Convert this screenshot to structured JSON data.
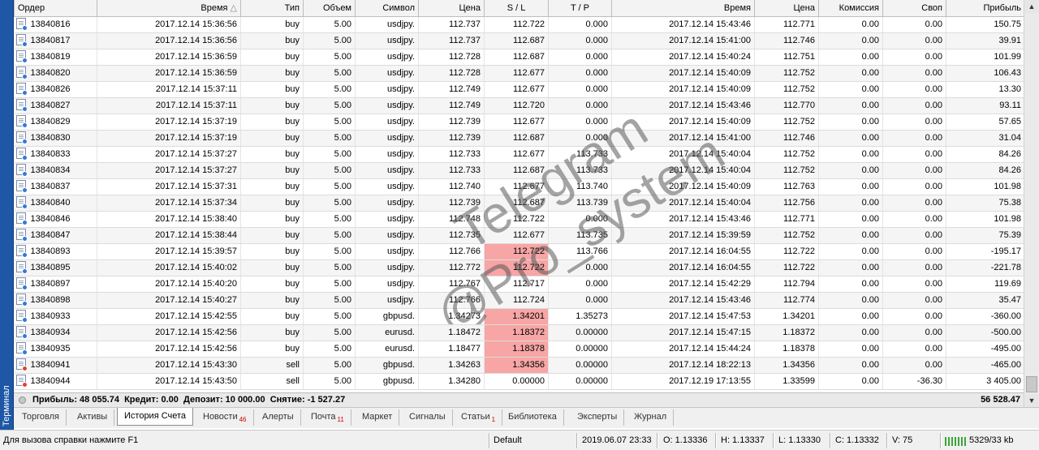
{
  "sidebar": {
    "label": "Терминал"
  },
  "columns": [
    "Ордер",
    "Время",
    "Тип",
    "Объем",
    "Символ",
    "Цена",
    "S / L",
    "T / P",
    "Время",
    "Цена",
    "Комиссия",
    "Своп",
    "Прибыль"
  ],
  "sort_indicator": "△",
  "rows": [
    {
      "order": "13840816",
      "open_time": "2017.12.14 15:36:56",
      "type": "buy",
      "volume": "5.00",
      "symbol": "usdjpy.",
      "price": "112.737",
      "sl": "112.722",
      "tp": "0.000",
      "close_time": "2017.12.14 15:43:46",
      "close_price": "112.771",
      "commission": "0.00",
      "swap": "0.00",
      "profit": "150.75",
      "sl_hit": false
    },
    {
      "order": "13840817",
      "open_time": "2017.12.14 15:36:56",
      "type": "buy",
      "volume": "5.00",
      "symbol": "usdjpy.",
      "price": "112.737",
      "sl": "112.687",
      "tp": "0.000",
      "close_time": "2017.12.14 15:41:00",
      "close_price": "112.746",
      "commission": "0.00",
      "swap": "0.00",
      "profit": "39.91",
      "sl_hit": false
    },
    {
      "order": "13840819",
      "open_time": "2017.12.14 15:36:59",
      "type": "buy",
      "volume": "5.00",
      "symbol": "usdjpy.",
      "price": "112.728",
      "sl": "112.687",
      "tp": "0.000",
      "close_time": "2017.12.14 15:40:24",
      "close_price": "112.751",
      "commission": "0.00",
      "swap": "0.00",
      "profit": "101.99",
      "sl_hit": false
    },
    {
      "order": "13840820",
      "open_time": "2017.12.14 15:36:59",
      "type": "buy",
      "volume": "5.00",
      "symbol": "usdjpy.",
      "price": "112.728",
      "sl": "112.677",
      "tp": "0.000",
      "close_time": "2017.12.14 15:40:09",
      "close_price": "112.752",
      "commission": "0.00",
      "swap": "0.00",
      "profit": "106.43",
      "sl_hit": false
    },
    {
      "order": "13840826",
      "open_time": "2017.12.14 15:37:11",
      "type": "buy",
      "volume": "5.00",
      "symbol": "usdjpy.",
      "price": "112.749",
      "sl": "112.677",
      "tp": "0.000",
      "close_time": "2017.12.14 15:40:09",
      "close_price": "112.752",
      "commission": "0.00",
      "swap": "0.00",
      "profit": "13.30",
      "sl_hit": false
    },
    {
      "order": "13840827",
      "open_time": "2017.12.14 15:37:11",
      "type": "buy",
      "volume": "5.00",
      "symbol": "usdjpy.",
      "price": "112.749",
      "sl": "112.720",
      "tp": "0.000",
      "close_time": "2017.12.14 15:43:46",
      "close_price": "112.770",
      "commission": "0.00",
      "swap": "0.00",
      "profit": "93.11",
      "sl_hit": false
    },
    {
      "order": "13840829",
      "open_time": "2017.12.14 15:37:19",
      "type": "buy",
      "volume": "5.00",
      "symbol": "usdjpy.",
      "price": "112.739",
      "sl": "112.677",
      "tp": "0.000",
      "close_time": "2017.12.14 15:40:09",
      "close_price": "112.752",
      "commission": "0.00",
      "swap": "0.00",
      "profit": "57.65",
      "sl_hit": false
    },
    {
      "order": "13840830",
      "open_time": "2017.12.14 15:37:19",
      "type": "buy",
      "volume": "5.00",
      "symbol": "usdjpy.",
      "price": "112.739",
      "sl": "112.687",
      "tp": "0.000",
      "close_time": "2017.12.14 15:41:00",
      "close_price": "112.746",
      "commission": "0.00",
      "swap": "0.00",
      "profit": "31.04",
      "sl_hit": false
    },
    {
      "order": "13840833",
      "open_time": "2017.12.14 15:37:27",
      "type": "buy",
      "volume": "5.00",
      "symbol": "usdjpy.",
      "price": "112.733",
      "sl": "112.677",
      "tp": "113.733",
      "close_time": "2017.12.14 15:40:04",
      "close_price": "112.752",
      "commission": "0.00",
      "swap": "0.00",
      "profit": "84.26",
      "sl_hit": false
    },
    {
      "order": "13840834",
      "open_time": "2017.12.14 15:37:27",
      "type": "buy",
      "volume": "5.00",
      "symbol": "usdjpy.",
      "price": "112.733",
      "sl": "112.687",
      "tp": "113.733",
      "close_time": "2017.12.14 15:40:04",
      "close_price": "112.752",
      "commission": "0.00",
      "swap": "0.00",
      "profit": "84.26",
      "sl_hit": false
    },
    {
      "order": "13840837",
      "open_time": "2017.12.14 15:37:31",
      "type": "buy",
      "volume": "5.00",
      "symbol": "usdjpy.",
      "price": "112.740",
      "sl": "112.677",
      "tp": "113.740",
      "close_time": "2017.12.14 15:40:09",
      "close_price": "112.763",
      "commission": "0.00",
      "swap": "0.00",
      "profit": "101.98",
      "sl_hit": false
    },
    {
      "order": "13840840",
      "open_time": "2017.12.14 15:37:34",
      "type": "buy",
      "volume": "5.00",
      "symbol": "usdjpy.",
      "price": "112.739",
      "sl": "112.687",
      "tp": "113.739",
      "close_time": "2017.12.14 15:40:04",
      "close_price": "112.756",
      "commission": "0.00",
      "swap": "0.00",
      "profit": "75.38",
      "sl_hit": false
    },
    {
      "order": "13840846",
      "open_time": "2017.12.14 15:38:40",
      "type": "buy",
      "volume": "5.00",
      "symbol": "usdjpy.",
      "price": "112.748",
      "sl": "112.722",
      "tp": "0.000",
      "close_time": "2017.12.14 15:43:46",
      "close_price": "112.771",
      "commission": "0.00",
      "swap": "0.00",
      "profit": "101.98",
      "sl_hit": false
    },
    {
      "order": "13840847",
      "open_time": "2017.12.14 15:38:44",
      "type": "buy",
      "volume": "5.00",
      "symbol": "usdjpy.",
      "price": "112.735",
      "sl": "112.677",
      "tp": "113.735",
      "close_time": "2017.12.14 15:39:59",
      "close_price": "112.752",
      "commission": "0.00",
      "swap": "0.00",
      "profit": "75.39",
      "sl_hit": false
    },
    {
      "order": "13840893",
      "open_time": "2017.12.14 15:39:57",
      "type": "buy",
      "volume": "5.00",
      "symbol": "usdjpy.",
      "price": "112.766",
      "sl": "112.722",
      "tp": "113.766",
      "close_time": "2017.12.14 16:04:55",
      "close_price": "112.722",
      "commission": "0.00",
      "swap": "0.00",
      "profit": "-195.17",
      "sl_hit": true
    },
    {
      "order": "13840895",
      "open_time": "2017.12.14 15:40:02",
      "type": "buy",
      "volume": "5.00",
      "symbol": "usdjpy.",
      "price": "112.772",
      "sl": "112.722",
      "tp": "0.000",
      "close_time": "2017.12.14 16:04:55",
      "close_price": "112.722",
      "commission": "0.00",
      "swap": "0.00",
      "profit": "-221.78",
      "sl_hit": true
    },
    {
      "order": "13840897",
      "open_time": "2017.12.14 15:40:20",
      "type": "buy",
      "volume": "5.00",
      "symbol": "usdjpy.",
      "price": "112.767",
      "sl": "112.717",
      "tp": "0.000",
      "close_time": "2017.12.14 15:42:29",
      "close_price": "112.794",
      "commission": "0.00",
      "swap": "0.00",
      "profit": "119.69",
      "sl_hit": false
    },
    {
      "order": "13840898",
      "open_time": "2017.12.14 15:40:27",
      "type": "buy",
      "volume": "5.00",
      "symbol": "usdjpy.",
      "price": "112.766",
      "sl": "112.724",
      "tp": "0.000",
      "close_time": "2017.12.14 15:43:46",
      "close_price": "112.774",
      "commission": "0.00",
      "swap": "0.00",
      "profit": "35.47",
      "sl_hit": false
    },
    {
      "order": "13840933",
      "open_time": "2017.12.14 15:42:55",
      "type": "buy",
      "volume": "5.00",
      "symbol": "gbpusd.",
      "price": "1.34273",
      "sl": "1.34201",
      "tp": "1.35273",
      "close_time": "2017.12.14 15:47:53",
      "close_price": "1.34201",
      "commission": "0.00",
      "swap": "0.00",
      "profit": "-360.00",
      "sl_hit": true
    },
    {
      "order": "13840934",
      "open_time": "2017.12.14 15:42:56",
      "type": "buy",
      "volume": "5.00",
      "symbol": "eurusd.",
      "price": "1.18472",
      "sl": "1.18372",
      "tp": "0.00000",
      "close_time": "2017.12.14 15:47:15",
      "close_price": "1.18372",
      "commission": "0.00",
      "swap": "0.00",
      "profit": "-500.00",
      "sl_hit": true
    },
    {
      "order": "13840935",
      "open_time": "2017.12.14 15:42:56",
      "type": "buy",
      "volume": "5.00",
      "symbol": "eurusd.",
      "price": "1.18477",
      "sl": "1.18378",
      "tp": "0.00000",
      "close_time": "2017.12.14 15:44:24",
      "close_price": "1.18378",
      "commission": "0.00",
      "swap": "0.00",
      "profit": "-495.00",
      "sl_hit": true
    },
    {
      "order": "13840941",
      "open_time": "2017.12.14 15:43:30",
      "type": "sell",
      "volume": "5.00",
      "symbol": "gbpusd.",
      "price": "1.34263",
      "sl": "1.34356",
      "tp": "0.00000",
      "close_time": "2017.12.14 18:22:13",
      "close_price": "1.34356",
      "commission": "0.00",
      "swap": "0.00",
      "profit": "-465.00",
      "sl_hit": true
    },
    {
      "order": "13840944",
      "open_time": "2017.12.14 15:43:50",
      "type": "sell",
      "volume": "5.00",
      "symbol": "gbpusd.",
      "price": "1.34280",
      "sl": "0.00000",
      "tp": "0.00000",
      "close_time": "2017.12.19 17:13:55",
      "close_price": "1.33599",
      "commission": "0.00",
      "swap": "-36.30",
      "profit": "3 405.00",
      "sl_hit": false
    }
  ],
  "summary": {
    "text": "Прибыль: 48 055.74  Кредит: 0.00  Депозит: 10 000.00  Снятие: -1 527.27",
    "total": "56 528.47"
  },
  "tabs": [
    {
      "label": "Торговля",
      "badge": "",
      "active": false
    },
    {
      "label": "Активы",
      "badge": "",
      "active": false
    },
    {
      "label": "История Счета",
      "badge": "",
      "active": true
    },
    {
      "label": "Новости",
      "badge": "46",
      "active": false
    },
    {
      "label": "Алерты",
      "badge": "",
      "active": false
    },
    {
      "label": "Почта",
      "badge": "11",
      "active": false
    },
    {
      "label": "Маркет",
      "badge": "",
      "active": false
    },
    {
      "label": "Сигналы",
      "badge": "",
      "active": false
    },
    {
      "label": "Статьи",
      "badge": "1",
      "active": false
    },
    {
      "label": "Библиотека",
      "badge": "",
      "active": false
    },
    {
      "label": "Эксперты",
      "badge": "",
      "active": false
    },
    {
      "label": "Журнал",
      "badge": "",
      "active": false
    }
  ],
  "statusbar": {
    "help": "Для вызова справки нажмите F1",
    "profile": "Default",
    "datetime": "2019.06.07 23:33",
    "open": "O: 1.13336",
    "high": "H: 1.13337",
    "low": "L: 1.13330",
    "close": "C: 1.13332",
    "volume": "V: 75",
    "traffic": "5329/33 kb"
  },
  "watermark": {
    "line1": "Telegram",
    "line2": "@Pro_system"
  },
  "colors": {
    "sl_hit_bg": "#f7a5a5",
    "sidebar_bg": "#1d57a6",
    "badge": "#d00000"
  },
  "icons": {
    "order_buy": "doc-blue-dot-icon",
    "order_sell": "doc-red-dot-icon"
  }
}
